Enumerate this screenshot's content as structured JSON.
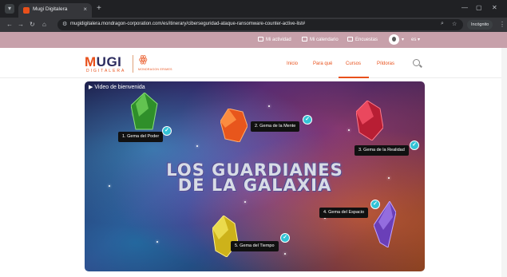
{
  "browser": {
    "tab_title": "Mugi Digitalera",
    "url": "mugidigitalera.mondragon-corporation.com/es/itinerary/ciberseguridad-ataque-ransomware-counter-active-list#",
    "incognito_label": "Incógnito"
  },
  "userbar": {
    "activity": "Mi actividad",
    "calendar": "Mi calendario",
    "surveys": "Encuestas",
    "language": "es"
  },
  "logo": {
    "wordmark_m": "M",
    "wordmark_rest": "UGI",
    "sub": "DIGITALERA",
    "tagline": "MONDRAGON ERIMES"
  },
  "nav": {
    "items": [
      "Inicio",
      "Para qué",
      "Cursos",
      "Píldoras"
    ],
    "active": "Cursos"
  },
  "video": {
    "label": "Video de bienvenida",
    "headline_1": "LOS GUARDIANES",
    "headline_2": "DE LA GALAXIA",
    "gems": [
      {
        "label": "1. Gema del Poder",
        "color": "#3fae3a"
      },
      {
        "label": "2. Gema de la Mente",
        "color": "#e8561c"
      },
      {
        "label": "3. Gema de la Realidad",
        "color": "#c4233a"
      },
      {
        "label": "4. Gema del Espacio",
        "color": "#7a4cc8"
      },
      {
        "label": "5. Gema del Tiempo",
        "color": "#d9c21a"
      }
    ],
    "check_glyph": "✓"
  }
}
